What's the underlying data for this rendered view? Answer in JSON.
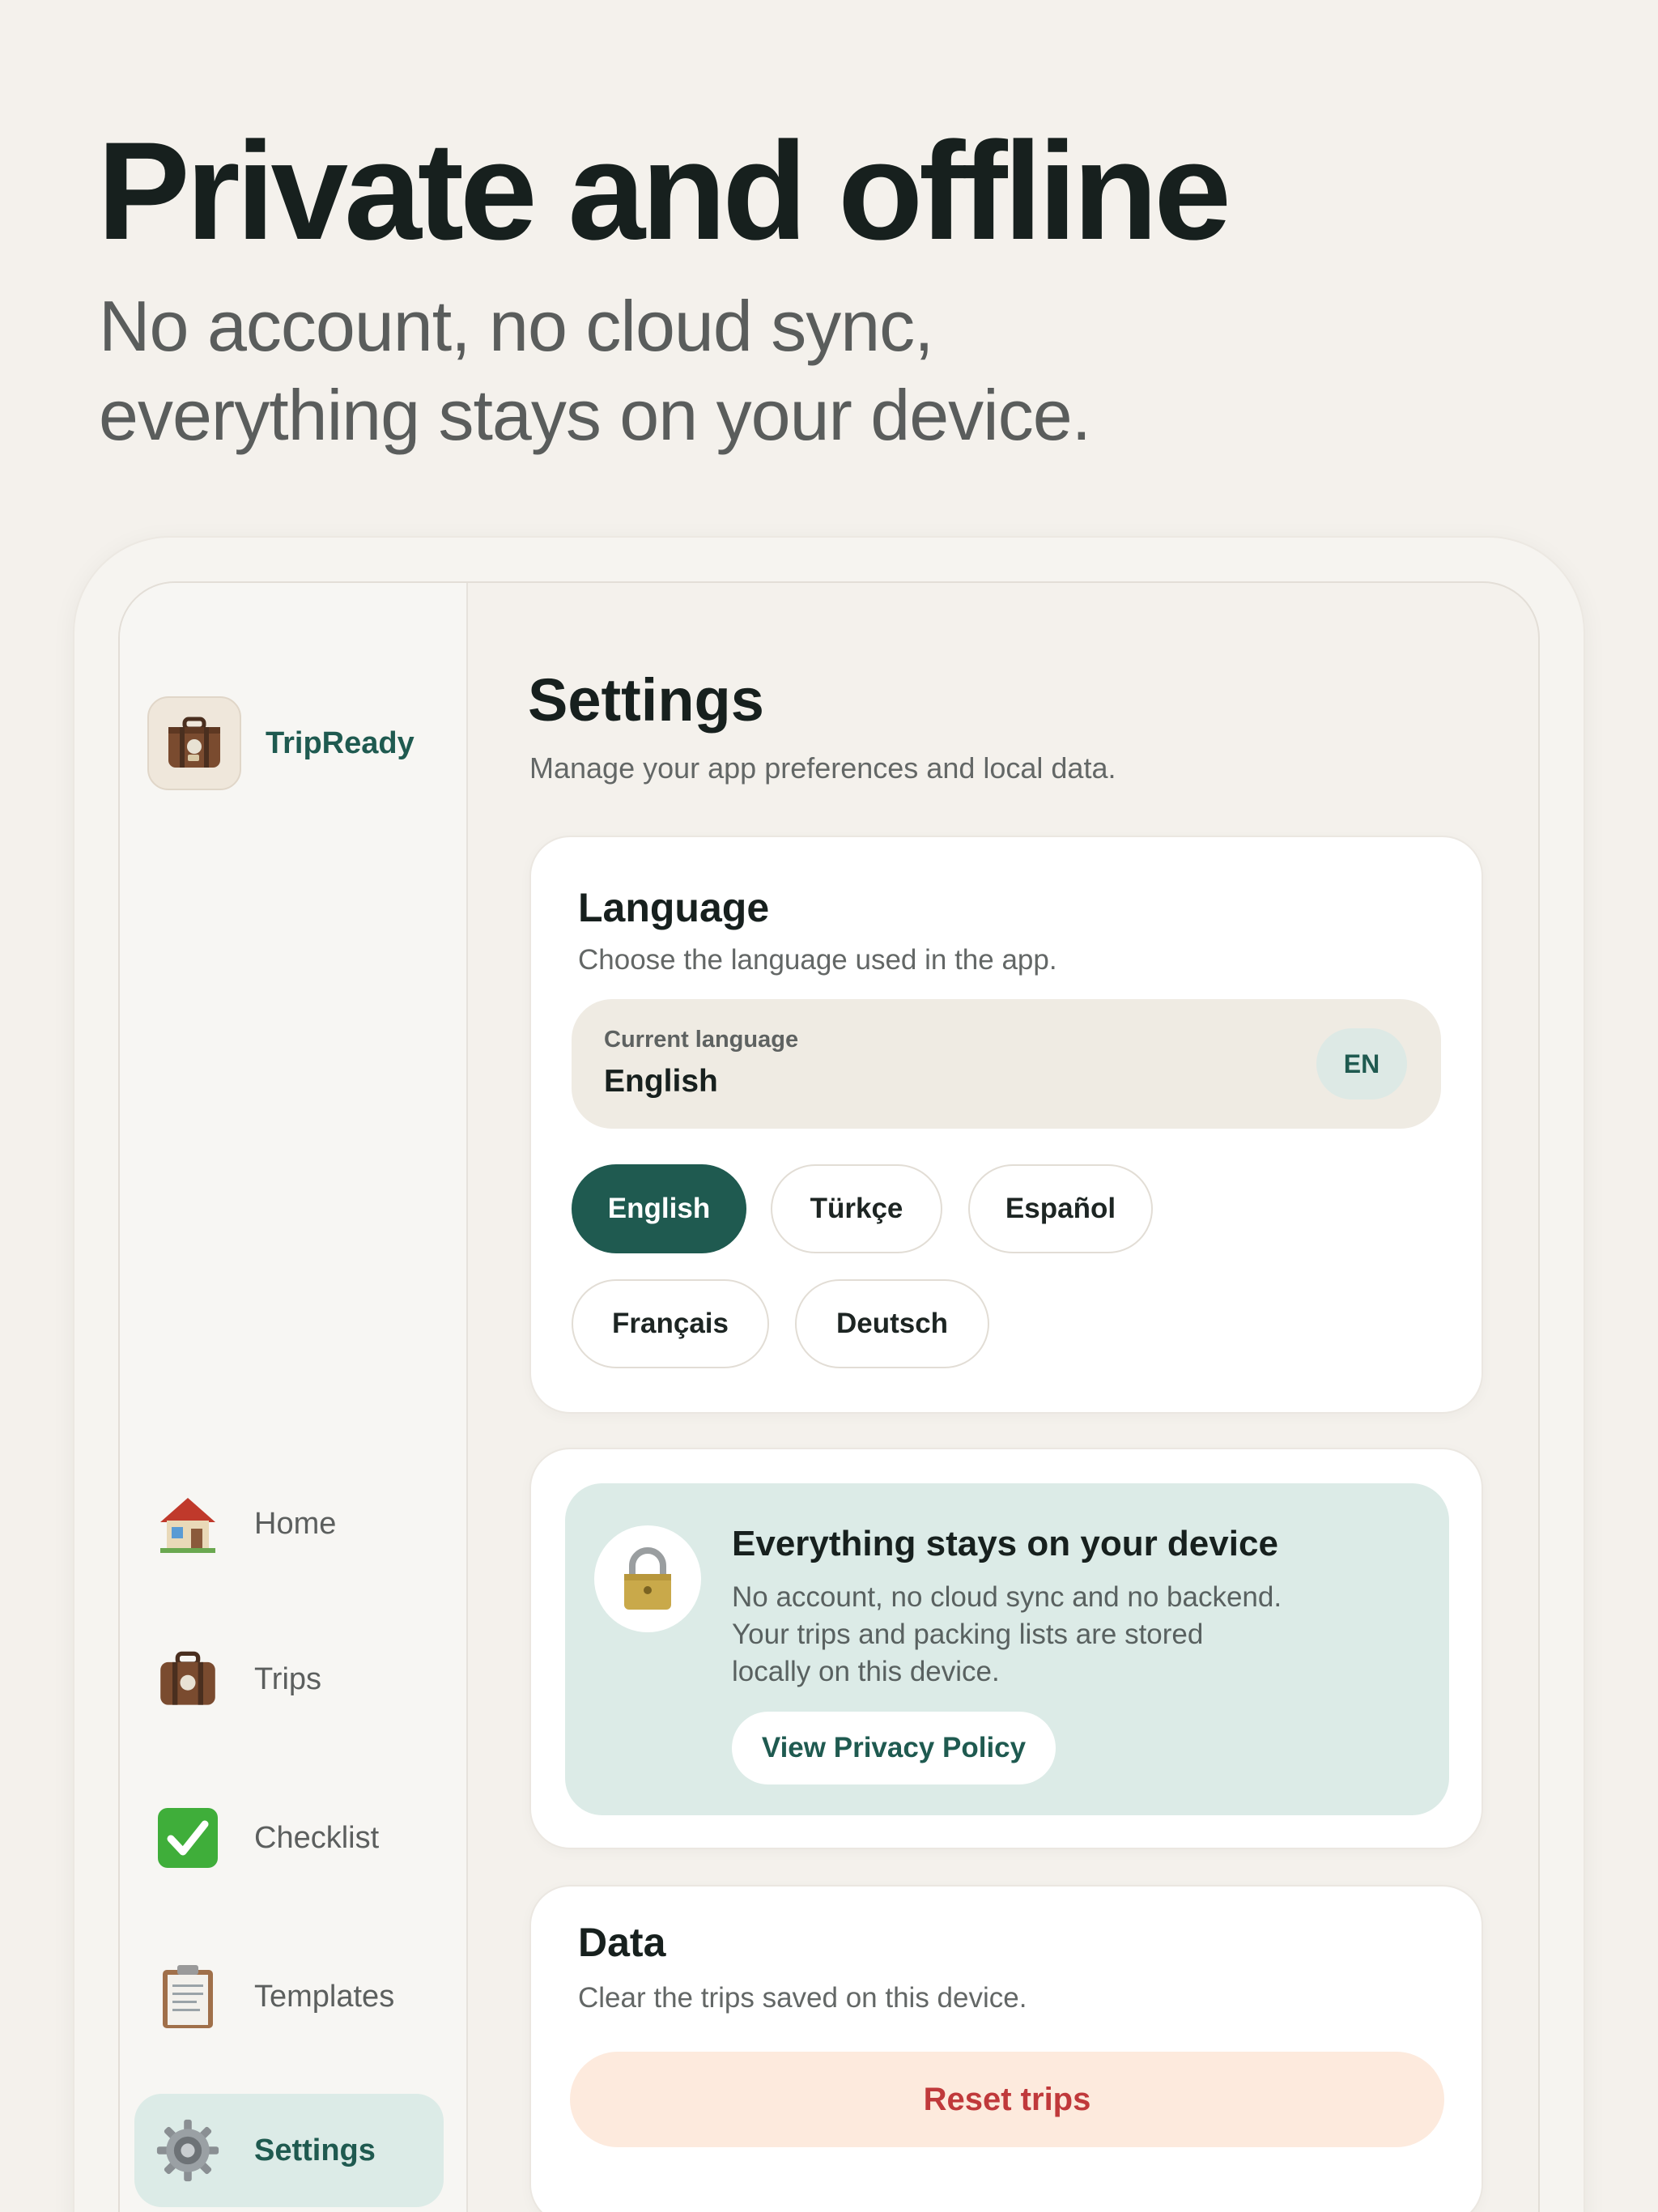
{
  "hero": {
    "title": "Private and offline",
    "subtitle_line1": "No account, no cloud sync,",
    "subtitle_line2": "everything stays on your device."
  },
  "sidebar": {
    "app_name": "TripReady",
    "app_icon": "suitcase-icon",
    "items": [
      {
        "label": "Home",
        "icon": "house-icon"
      },
      {
        "label": "Trips",
        "icon": "suitcase-icon"
      },
      {
        "label": "Checklist",
        "icon": "check-mark-icon"
      },
      {
        "label": "Templates",
        "icon": "clipboard-icon"
      },
      {
        "label": "Settings",
        "icon": "gear-icon",
        "active": true
      }
    ]
  },
  "settings": {
    "title": "Settings",
    "subtitle": "Manage your app preferences and local data."
  },
  "language": {
    "title": "Language",
    "description": "Choose the language used in the app.",
    "current_label": "Current language",
    "current_value": "English",
    "current_code": "EN",
    "options": [
      "English",
      "Türkçe",
      "Español",
      "Français",
      "Deutsch"
    ],
    "selected": "English"
  },
  "privacy": {
    "icon": "lock-icon",
    "title": "Everything stays on your device",
    "body_line1": "No account, no cloud sync and no backend.",
    "body_line2": "Your trips and packing lists are stored",
    "body_line3": "locally on this device.",
    "button": "View Privacy Policy"
  },
  "data": {
    "title": "Data",
    "description": "Clear the trips saved on this device.",
    "reset_button": "Reset trips"
  },
  "colors": {
    "accent": "#1f5a50",
    "background": "#f4f1ec",
    "privacy_panel": "#dcebe7",
    "danger": "#c0393b",
    "danger_bg": "#fdeadd"
  }
}
